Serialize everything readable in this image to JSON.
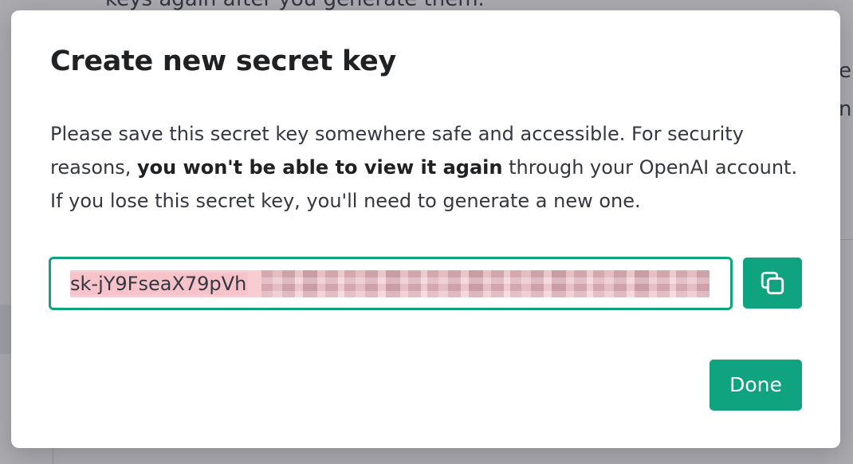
{
  "background": {
    "partial_text_top": "keys again after you generate them.",
    "partial_glyph_1": "e",
    "partial_glyph_2": "n"
  },
  "modal": {
    "title": "Create new secret key",
    "description": {
      "part1": "Please save this secret key somewhere safe and accessible. For security reasons, ",
      "bold": "you won't be able to view it again",
      "part2": " through your OpenAI account. If you lose this secret key, you'll need to generate a new one."
    },
    "secret_key": {
      "visible_value": "sk-jY9FseaX79pVh"
    },
    "copy_button": {
      "icon": "copy-icon"
    },
    "done_button": {
      "label": "Done"
    }
  },
  "colors": {
    "accent": "#10a37f",
    "title_text": "#202123",
    "body_text": "#353740",
    "key_highlight": "#f8cdd2"
  }
}
